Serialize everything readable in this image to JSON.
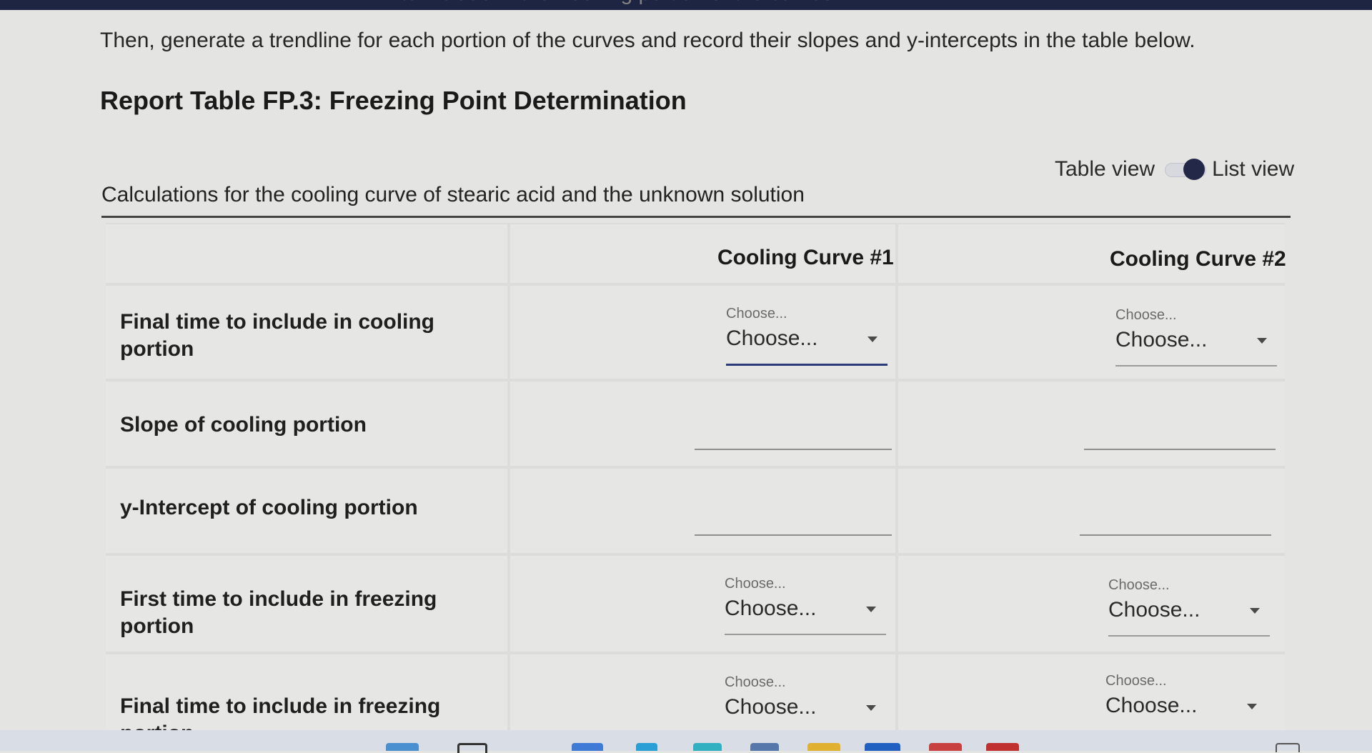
{
  "header": {
    "cut_text": "to include in the freezing portion of the curves",
    "intro": "Then, generate a trendline for each portion of the curves and record their slopes and y-intercepts in the table below.",
    "report_title": "Report Table FP.3: Freezing Point Determination"
  },
  "view_toggle": {
    "table_label": "Table view",
    "list_label": "List view",
    "selected": "List view"
  },
  "table": {
    "caption": "Calculations for the cooling curve of stearic acid and the unknown solution",
    "columns": [
      "Cooling Curve #1",
      "Cooling Curve #2"
    ],
    "rows": [
      {
        "label": "Final time to include in cooling portion",
        "c1": {
          "hint": "Choose...",
          "value": "Choose..."
        },
        "c2": {
          "hint": "Choose...",
          "value": "Choose..."
        }
      },
      {
        "label": "Slope of cooling portion",
        "c1": {
          "value": ""
        },
        "c2": {
          "value": ""
        }
      },
      {
        "label": "y-Intercept of cooling portion",
        "c1": {
          "value": ""
        },
        "c2": {
          "value": ""
        }
      },
      {
        "label": "First time to include in freezing portion",
        "c1": {
          "hint": "Choose...",
          "value": "Choose..."
        },
        "c2": {
          "hint": "Choose...",
          "value": "Choose..."
        }
      },
      {
        "label": "Final time to include in freezing portion",
        "c1": {
          "hint": "Choose...",
          "value": "Choose..."
        },
        "c2": {
          "hint": "Choose...",
          "value": "Choose..."
        }
      }
    ]
  },
  "colors": {
    "accent": "#2b3a78",
    "toggle_knob": "#232848",
    "topbar": "#1e2542"
  }
}
